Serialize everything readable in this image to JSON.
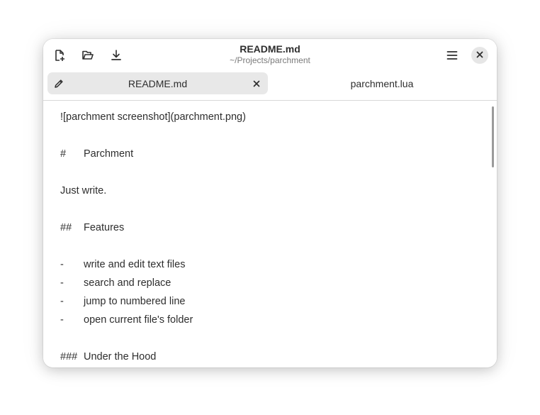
{
  "window": {
    "title": "README.md",
    "subtitle": "~/Projects/parchment"
  },
  "headerbar": {
    "icons": [
      "new-file-icon",
      "open-folder-icon",
      "save-download-icon",
      "hamburger-menu-icon",
      "close-icon"
    ]
  },
  "tabs": [
    {
      "label": "README.md",
      "active": true,
      "icon": "pencil-icon",
      "close_icon": "close-icon"
    },
    {
      "label": "parchment.lua",
      "active": false
    }
  ],
  "editor": {
    "lines": [
      {
        "mark": "",
        "text": "![parchment screenshot](parchment.png)"
      },
      {
        "mark": "#",
        "text": "Parchment"
      },
      {
        "mark": "",
        "text": "Just write."
      },
      {
        "mark": "##",
        "text": "Features"
      },
      {
        "mark": "-",
        "text": "write and edit text files"
      },
      {
        "mark": "-",
        "text": "search and replace"
      },
      {
        "mark": "-",
        "text": "jump to numbered line"
      },
      {
        "mark": "-",
        "text": "open current file's folder"
      },
      {
        "mark": "###",
        "text": "Under the Hood"
      }
    ]
  }
}
